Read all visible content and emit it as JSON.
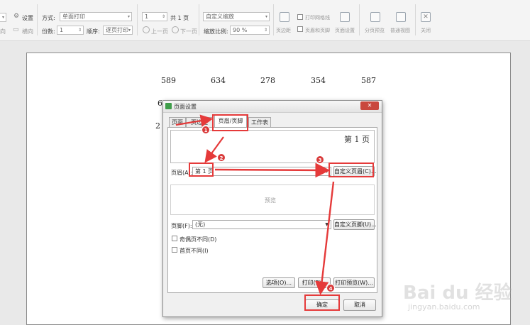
{
  "toolbar": {
    "setup_label": "设置",
    "landscape_label": "横向",
    "method_label": "方式:",
    "method_value": "单面打印",
    "copies_label": "份数:",
    "copies_value": "1",
    "order_label": "顺序:",
    "order_value": "逐页打印",
    "page_value": "1",
    "total_pages": "共 1 页",
    "prev_page": "上一页",
    "next_page": "下一页",
    "zoom_mode": "自定义缩放",
    "zoom_label": "缩放比例:",
    "zoom_value": "90 %",
    "margins": "页边距",
    "gridlines": "打印网格线",
    "header_footer": "页眉和页脚",
    "page_setup": "页面设置",
    "page_break_preview": "分页预览",
    "normal_view": "普通视图",
    "close": "关闭"
  },
  "document": {
    "row1": [
      "589",
      "634",
      "278",
      "354",
      "587"
    ],
    "row2_first": "6",
    "row3_first": "2"
  },
  "dialog": {
    "title": "页面设置",
    "close": "✕",
    "tabs": [
      "页面",
      "页边距",
      "页眉/页脚",
      "工作表"
    ],
    "header_preview": "第 1 页",
    "header_label": "页眉(A):",
    "header_value": "第 1 页",
    "custom_header": "自定义页眉(C)...",
    "preview_placeholder": "预览",
    "footer_label": "页脚(F):",
    "footer_value": "(无)",
    "custom_footer": "自定义页脚(U)...",
    "odd_even": "奇偶页不同(D)",
    "first_page": "首页不同(I)",
    "options": "选项(O)...",
    "print": "打印(P)...",
    "print_preview": "打印预览(W)...",
    "ok": "确定",
    "cancel": "取消"
  },
  "annotations": {
    "colors": {
      "accent": "#e53a3a"
    },
    "steps": [
      "1",
      "2",
      "3",
      "4"
    ]
  },
  "watermark": {
    "logo": "Bai du 经验",
    "url": "jingyan.baidu.com"
  }
}
